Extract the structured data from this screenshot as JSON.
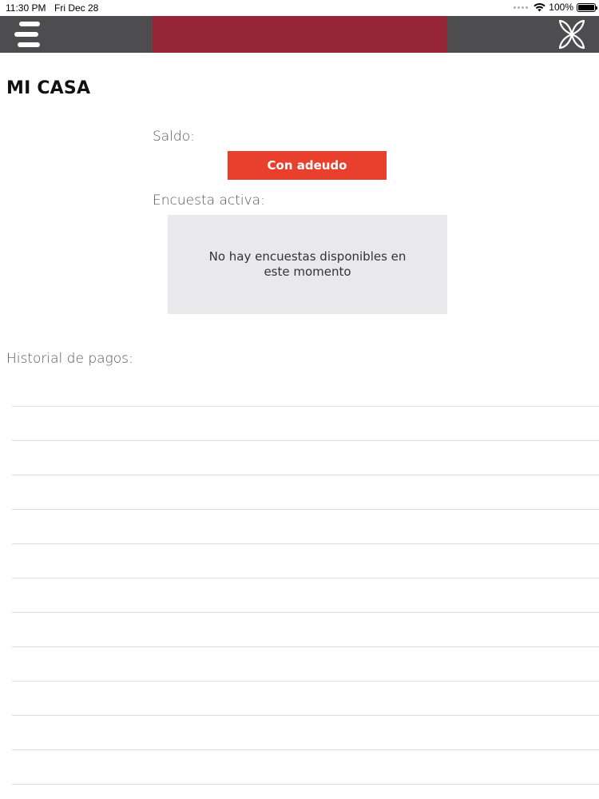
{
  "status_bar": {
    "time": "11:30 PM",
    "date": "Fri Dec 28",
    "battery_text": "100%",
    "battery_level": 1.0,
    "wifi_icon": "wifi-icon",
    "battery_icon": "battery-icon"
  },
  "header": {
    "menu_icon": "hamburger-menu-icon",
    "logo_icon": "flower-logo-icon",
    "colors": {
      "bar": "#4d4d4f",
      "center": "#962538"
    }
  },
  "page": {
    "title": "MI CASA",
    "balance_label": "Saldo:",
    "balance_status": "Con adeudo",
    "balance_status_color": "#e8402d",
    "survey_label": "Encuesta activa:",
    "survey_message": "No hay encuestas disponibles en este momento",
    "history_label": "Historial de pagos:",
    "history_rows": [
      "",
      "",
      "",
      "",
      "",
      "",
      "",
      "",
      "",
      "",
      "",
      ""
    ]
  }
}
